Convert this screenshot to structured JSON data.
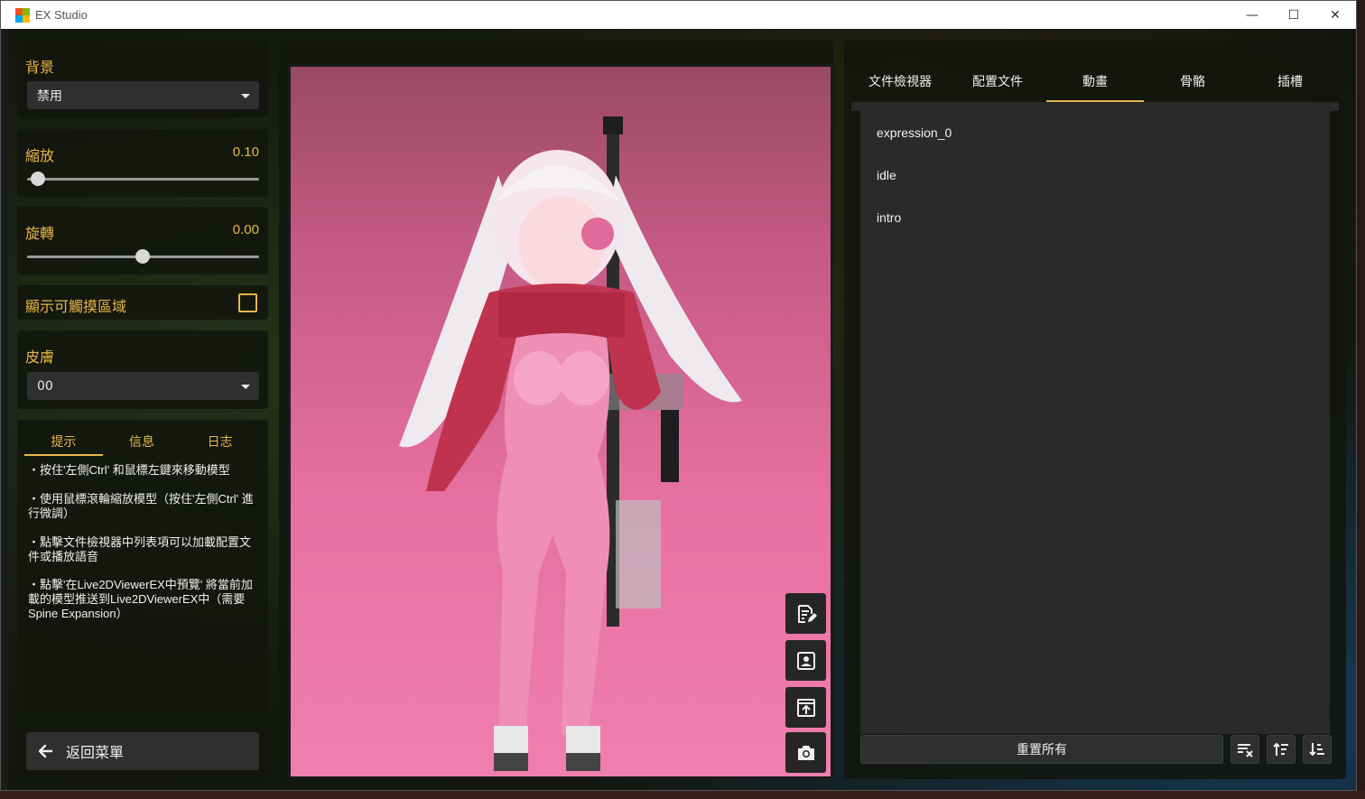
{
  "window": {
    "title": "EX Studio",
    "minimize": "—",
    "maximize": "☐",
    "close": "✕"
  },
  "colors": {
    "accent": "#e8b64a",
    "panel": "#2f2f2f",
    "viewport_top": "#9a4a63",
    "viewport_bottom": "#f07fae"
  },
  "left": {
    "background": {
      "label": "背景",
      "value": "禁用"
    },
    "scale": {
      "label": "縮放",
      "value": "0.10",
      "fraction": 0.03
    },
    "rotate": {
      "label": "旋轉",
      "value": "0.00",
      "fraction": 0.5
    },
    "hitarea": {
      "label": "顯示可觸摸區域",
      "checked": false
    },
    "skin": {
      "label": "皮膚",
      "value": "00"
    },
    "tips_tabs": [
      "提示",
      "信息",
      "日志"
    ],
    "tips": [
      "・按住'左側Ctrl' 和鼠標左鍵來移動模型",
      "・使用鼠標滾輪縮放模型（按住'左側Ctrl' 進行微調）",
      "・點擊文件檢視器中列表項可以加載配置文件或播放語音",
      "・點擊'在Live2DViewerEX中預覽' 將當前加載的模型推送到Live2DViewerEX中（需要Spine Expansion）"
    ],
    "back_label": "返回菜單"
  },
  "viewport_buttons": [
    "edit-document-icon",
    "portrait-icon",
    "export-icon",
    "camera-icon"
  ],
  "right": {
    "tabs": [
      "文件檢視器",
      "配置文件",
      "動畫",
      "骨骼",
      "插槽"
    ],
    "active_tab": 2,
    "animations": [
      "expression_0",
      "idle",
      "intro"
    ],
    "reset_label": "重置所有",
    "icon_buttons": [
      "clear-sort-icon",
      "sort-ascending-icon",
      "sort-descending-icon"
    ]
  }
}
